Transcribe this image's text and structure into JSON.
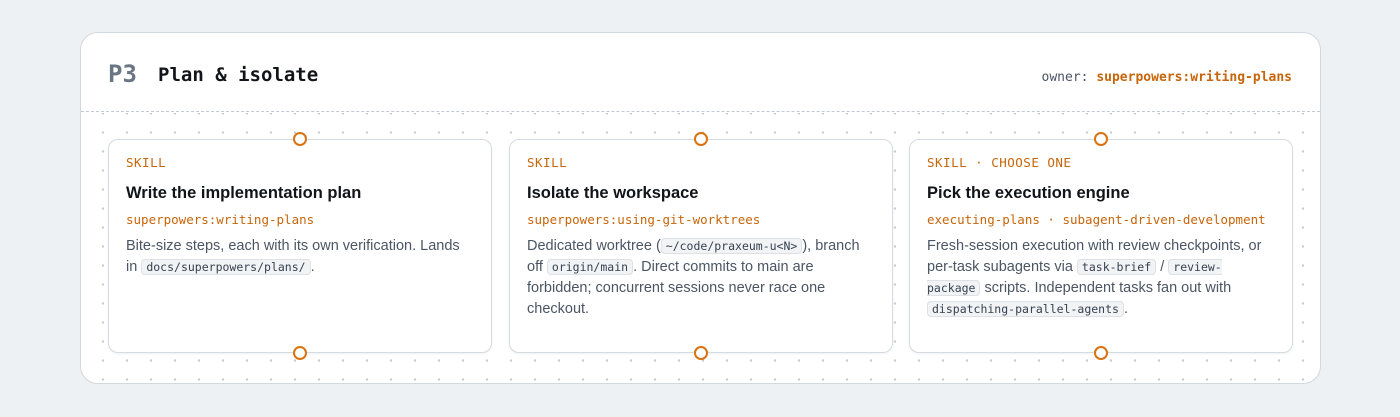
{
  "phase": {
    "id": "P3",
    "title": "Plan & isolate",
    "owner_label": "owner:",
    "owner_value": "superpowers:writing-plans"
  },
  "cards": [
    {
      "tag": "SKILL",
      "title": "Write the implementation plan",
      "skill_id": "superpowers:writing-plans",
      "desc": {
        "t1": "Bite-size steps, each with its own verification. Lands in ",
        "c1": "docs/superpowers/plans/",
        "t2": "."
      }
    },
    {
      "tag": "SKILL",
      "title": "Isolate the workspace",
      "skill_id": "superpowers:using-git-worktrees",
      "desc": {
        "t1": "Dedicated worktree (",
        "c1": "~/code/praxeum-u<N>",
        "t2": "), branch off ",
        "c2": "origin/main",
        "t3": ". Direct commits to main are forbidden; concurrent sessions never race one checkout."
      }
    },
    {
      "tag": "SKILL · CHOOSE ONE",
      "title": "Pick the execution engine",
      "skill_id": "executing-plans · subagent-driven-development",
      "desc": {
        "t1": "Fresh-session execution with review checkpoints, or per-task subagents via ",
        "c1": "task-brief",
        "t2": " / ",
        "c2": "review-package",
        "t3": " scripts. Independent tasks fan out with ",
        "c3": "dispatching-parallel-agents",
        "t4": "."
      }
    }
  ],
  "colors": {
    "accent": "#c7650a",
    "port": "#d9720f",
    "background": "#eef1f4"
  }
}
